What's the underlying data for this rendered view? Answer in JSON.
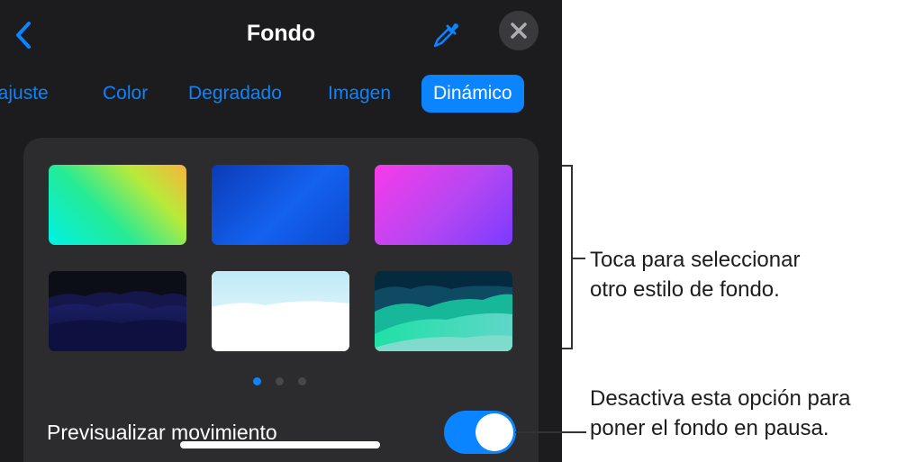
{
  "header": {
    "title": "Fondo",
    "back_icon": "chevron-left-icon",
    "picker_icon": "eyedropper-icon",
    "close_icon": "close-icon"
  },
  "tabs": [
    {
      "label": "eajuste",
      "active": false
    },
    {
      "label": "Color",
      "active": false
    },
    {
      "label": "Degradado",
      "active": false
    },
    {
      "label": "Imagen",
      "active": false
    },
    {
      "label": "Dinámico",
      "active": true
    }
  ],
  "dynamic_styles": {
    "selected_index": null,
    "thumbnails": [
      {
        "name": "green-yellow-gradient"
      },
      {
        "name": "blue-gradient"
      },
      {
        "name": "pink-purple-gradient"
      },
      {
        "name": "dark-blue-landscape"
      },
      {
        "name": "light-sky-landscape"
      },
      {
        "name": "teal-landscape"
      }
    ]
  },
  "pagination": {
    "pages": 3,
    "current": 1
  },
  "motion_preview": {
    "label": "Previsualizar movimiento",
    "enabled": true
  },
  "callouts": {
    "styles_line1": "Toca para seleccionar",
    "styles_line2": "otro estilo de fondo.",
    "toggle_line1": "Desactiva esta opción para",
    "toggle_line2": "poner el fondo en pausa."
  },
  "colors": {
    "accent": "#0a84ff",
    "panel_bg": "#1c1c1e",
    "card_bg": "#2c2c2e"
  }
}
